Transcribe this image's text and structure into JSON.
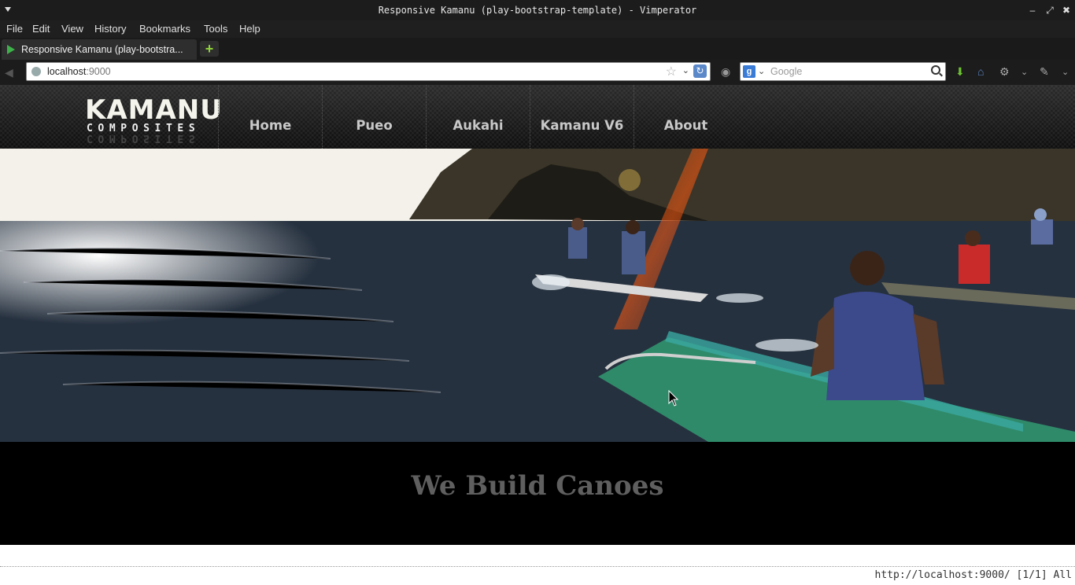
{
  "window": {
    "title": "Responsive Kamanu (play-bootstrap-template) - Vimperator"
  },
  "menu": {
    "items": [
      "File",
      "Edit",
      "View",
      "History",
      "Bookmarks",
      "Tools",
      "Help"
    ]
  },
  "tabs": [
    {
      "label": "Responsive Kamanu (play-bootstra...",
      "active": true
    }
  ],
  "navbar": {
    "url_host": "localhost",
    "url_port": ":9000",
    "search_placeholder": "Google",
    "search_engine_icon": "google-icon"
  },
  "site": {
    "logo_word": "KAMANU",
    "logo_sub": "COMPOSITES",
    "nav": [
      "Home",
      "Pueo",
      "Aukahi",
      "Kamanu V6",
      "About"
    ],
    "hero_image": "outrigger-canoe-paddlers-at-sea",
    "tagline": "We Build Canoes"
  },
  "statusbar": {
    "text": "http://localhost:9000/ [1/1] All"
  },
  "colors": {
    "header_bg": "#1a1a1a",
    "nav_text": "#c8c8c8",
    "tagline_text": "#5f5f5f",
    "tab_favicon": "#3eb14a"
  }
}
